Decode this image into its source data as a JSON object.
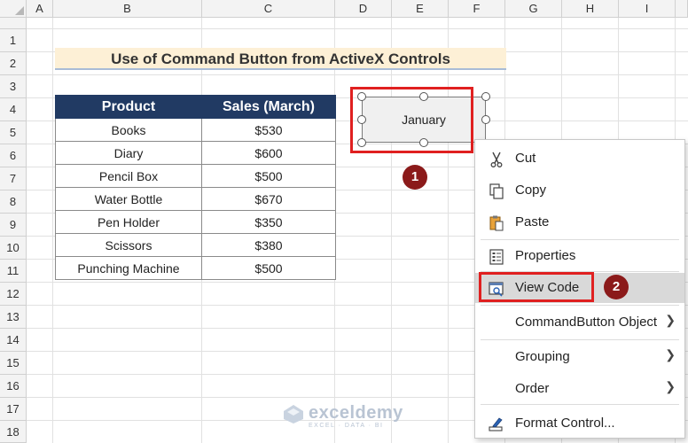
{
  "columns": [
    "A",
    "B",
    "C",
    "D",
    "E",
    "F",
    "G",
    "H",
    "I"
  ],
  "rows": [
    "1",
    "2",
    "3",
    "4",
    "5",
    "6",
    "7",
    "8",
    "9",
    "10",
    "11",
    "12",
    "13",
    "14",
    "15",
    "16",
    "17",
    "18"
  ],
  "title": "Use of Command Button from ActiveX Controls",
  "table": {
    "headers": [
      "Product",
      "Sales (March)"
    ],
    "rows": [
      [
        "Books",
        "$530"
      ],
      [
        "Diary",
        "$600"
      ],
      [
        "Pencil Box",
        "$500"
      ],
      [
        "Water Bottle",
        "$670"
      ],
      [
        "Pen Holder",
        "$350"
      ],
      [
        "Scissors",
        "$380"
      ],
      [
        "Punching Machine",
        "$500"
      ]
    ]
  },
  "command_button": {
    "label": "January"
  },
  "steps": {
    "one": "1",
    "two": "2"
  },
  "context_menu": {
    "items": [
      {
        "label": "Cut",
        "icon": "scissors-icon"
      },
      {
        "label": "Copy",
        "icon": "copy-icon"
      },
      {
        "label": "Paste",
        "icon": "paste-icon"
      },
      {
        "label": "Properties",
        "icon": "properties-icon"
      },
      {
        "label": "View Code",
        "icon": "view-code-icon"
      },
      {
        "label": "CommandButton Object",
        "icon": ""
      },
      {
        "label": "Grouping",
        "icon": ""
      },
      {
        "label": "Order",
        "icon": ""
      },
      {
        "label": "Format Control...",
        "icon": "format-control-icon"
      }
    ]
  },
  "watermark": {
    "name": "exceldemy",
    "tagline": "EXCEL · DATA · BI"
  },
  "colors": {
    "header_fill": "#213a63",
    "title_fill": "#fdf0d6",
    "highlight_red": "#e02020",
    "step_badge": "#8b1a1a"
  }
}
